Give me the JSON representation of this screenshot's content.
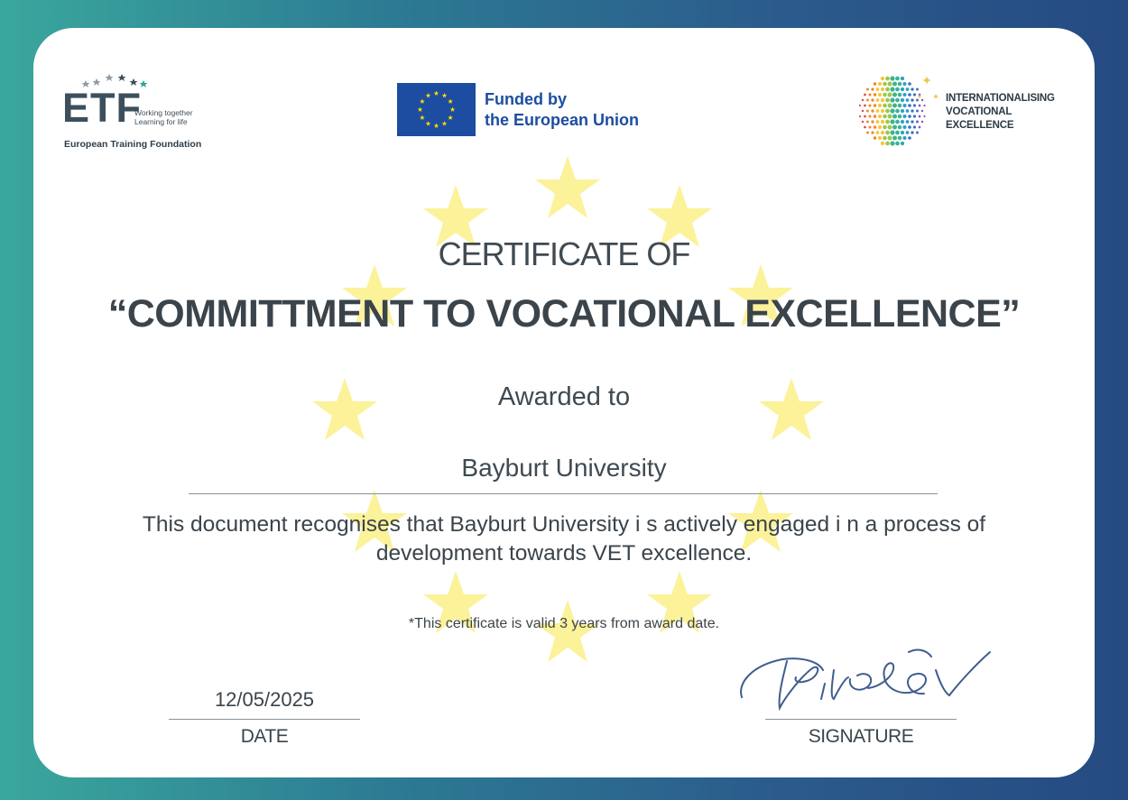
{
  "logos": {
    "etf": {
      "word": "ETF",
      "tagline_1": "Working together",
      "tagline_2": "Learning for life",
      "name": "European Training Foundation"
    },
    "eu": {
      "line_1": "Funded by",
      "line_2": "the European Union",
      "flag_color": "#1c4da0",
      "star_color": "#ffdd00"
    },
    "ive": {
      "line_1": "INTERNATIONALISING",
      "line_2": "VOCATIONAL",
      "line_3": "EXCELLENCE"
    }
  },
  "certificate": {
    "title_line_1": "CERTIFICATE OF",
    "title_line_2": "“COMMITTMENT TO VOCATIONAL EXCELLENCE”",
    "awarded_to_label": "Awarded to",
    "recipient": "Bayburt University",
    "description": "This document recognises that Bayburt University i s actively engaged i n a process of development towards VET excellence.",
    "validity_note": "*This certificate is valid 3 years from award date."
  },
  "footer": {
    "date_value": "12/05/2025",
    "date_label": "DATE",
    "signature_label": "SIGNATURE"
  },
  "colors": {
    "background_gradient_start": "#3aa79d",
    "background_gradient_end": "#254b82",
    "watermark_star": "#fbf29a",
    "text": "#3b444b"
  }
}
